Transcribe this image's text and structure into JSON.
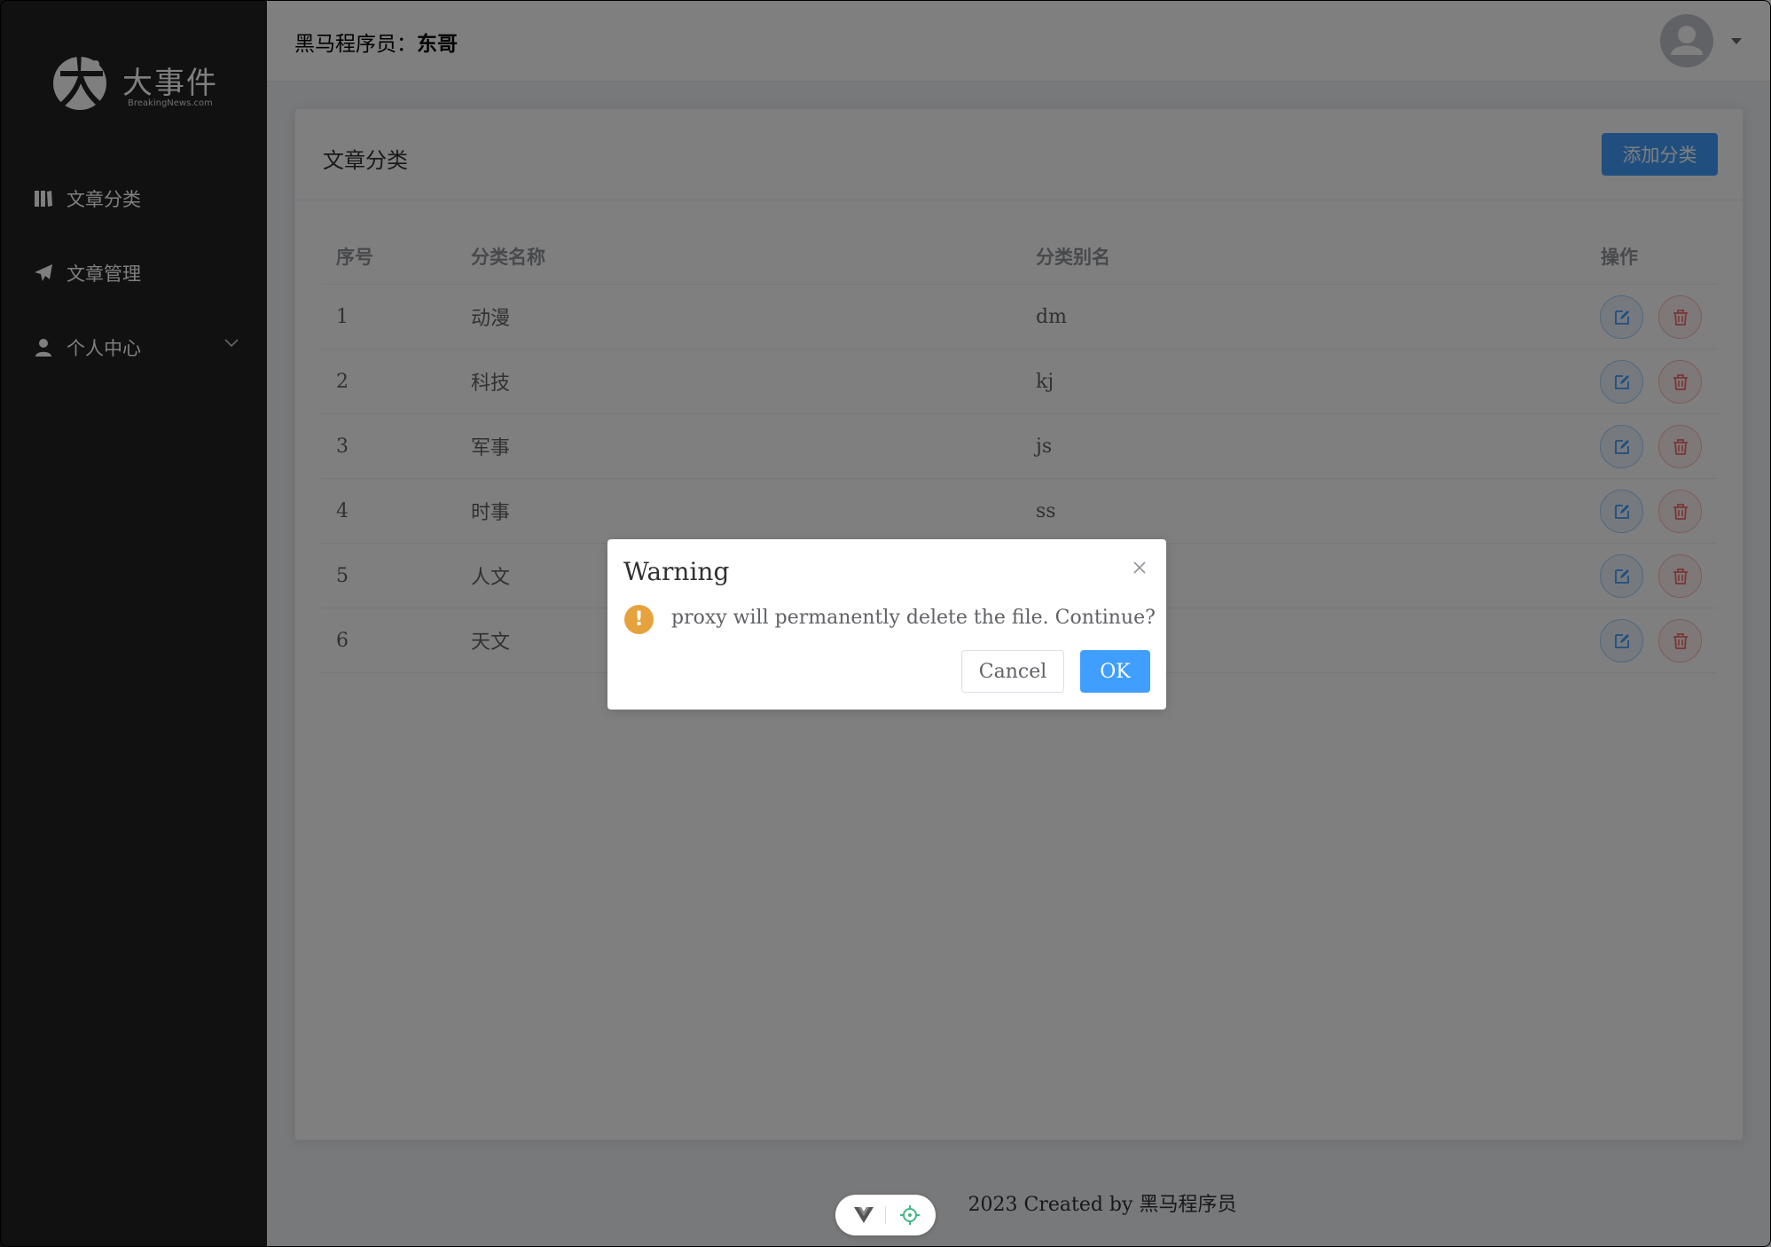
{
  "sidebar": {
    "logo_text": "大事件",
    "logo_sub": "BreakingNews.com",
    "items": [
      {
        "label": "文章分类",
        "icon": "category-icon"
      },
      {
        "label": "文章管理",
        "icon": "paper-plane-icon"
      },
      {
        "label": "个人中心",
        "icon": "user-icon"
      }
    ]
  },
  "header": {
    "user_prefix": "黑马程序员：",
    "user_name": "东哥"
  },
  "card": {
    "title": "文章分类",
    "add_button": "添加分类"
  },
  "table": {
    "columns": [
      "序号",
      "分类名称",
      "分类别名",
      "操作"
    ],
    "rows": [
      {
        "index": "1",
        "name": "动漫",
        "alias": "dm"
      },
      {
        "index": "2",
        "name": "科技",
        "alias": "kj"
      },
      {
        "index": "3",
        "name": "军事",
        "alias": "js"
      },
      {
        "index": "4",
        "name": "时事",
        "alias": "ss"
      },
      {
        "index": "5",
        "name": "人文",
        "alias": ""
      },
      {
        "index": "6",
        "name": "天文",
        "alias": ""
      }
    ]
  },
  "footer": {
    "text": "2023 Created by 黑马程序员"
  },
  "dialog": {
    "title": "Warning",
    "message": "proxy will permanently delete the file. Continue?",
    "cancel_label": "Cancel",
    "ok_label": "OK",
    "icon": "warning-icon"
  },
  "colors": {
    "primary": "#409eff",
    "danger": "#f56c6c",
    "warning": "#e6a23c",
    "sidebar_bg": "#232323"
  }
}
